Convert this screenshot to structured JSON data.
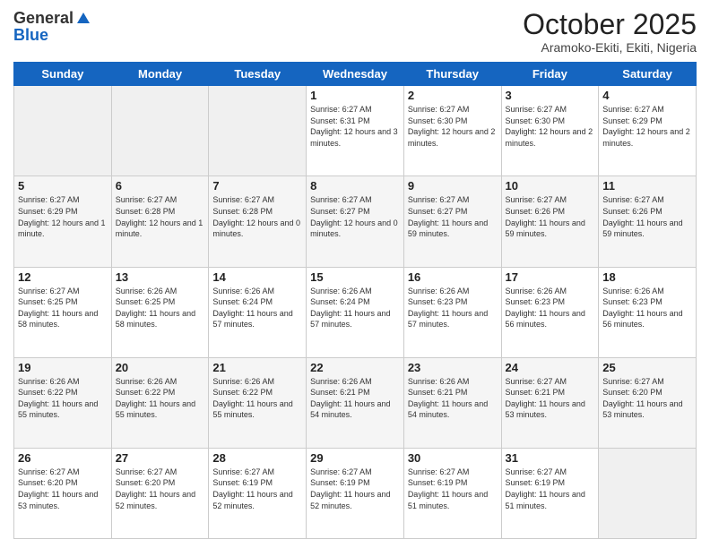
{
  "logo": {
    "general": "General",
    "blue": "Blue"
  },
  "header": {
    "month": "October 2025",
    "location": "Aramoko-Ekiti, Ekiti, Nigeria"
  },
  "days_of_week": [
    "Sunday",
    "Monday",
    "Tuesday",
    "Wednesday",
    "Thursday",
    "Friday",
    "Saturday"
  ],
  "weeks": [
    [
      {
        "day": "",
        "sunrise": "",
        "sunset": "",
        "daylight": "",
        "empty": true
      },
      {
        "day": "",
        "sunrise": "",
        "sunset": "",
        "daylight": "",
        "empty": true
      },
      {
        "day": "",
        "sunrise": "",
        "sunset": "",
        "daylight": "",
        "empty": true
      },
      {
        "day": "1",
        "sunrise": "Sunrise: 6:27 AM",
        "sunset": "Sunset: 6:31 PM",
        "daylight": "Daylight: 12 hours and 3 minutes."
      },
      {
        "day": "2",
        "sunrise": "Sunrise: 6:27 AM",
        "sunset": "Sunset: 6:30 PM",
        "daylight": "Daylight: 12 hours and 2 minutes."
      },
      {
        "day": "3",
        "sunrise": "Sunrise: 6:27 AM",
        "sunset": "Sunset: 6:30 PM",
        "daylight": "Daylight: 12 hours and 2 minutes."
      },
      {
        "day": "4",
        "sunrise": "Sunrise: 6:27 AM",
        "sunset": "Sunset: 6:29 PM",
        "daylight": "Daylight: 12 hours and 2 minutes."
      }
    ],
    [
      {
        "day": "5",
        "sunrise": "Sunrise: 6:27 AM",
        "sunset": "Sunset: 6:29 PM",
        "daylight": "Daylight: 12 hours and 1 minute."
      },
      {
        "day": "6",
        "sunrise": "Sunrise: 6:27 AM",
        "sunset": "Sunset: 6:28 PM",
        "daylight": "Daylight: 12 hours and 1 minute."
      },
      {
        "day": "7",
        "sunrise": "Sunrise: 6:27 AM",
        "sunset": "Sunset: 6:28 PM",
        "daylight": "Daylight: 12 hours and 0 minutes."
      },
      {
        "day": "8",
        "sunrise": "Sunrise: 6:27 AM",
        "sunset": "Sunset: 6:27 PM",
        "daylight": "Daylight: 12 hours and 0 minutes."
      },
      {
        "day": "9",
        "sunrise": "Sunrise: 6:27 AM",
        "sunset": "Sunset: 6:27 PM",
        "daylight": "Daylight: 11 hours and 59 minutes."
      },
      {
        "day": "10",
        "sunrise": "Sunrise: 6:27 AM",
        "sunset": "Sunset: 6:26 PM",
        "daylight": "Daylight: 11 hours and 59 minutes."
      },
      {
        "day": "11",
        "sunrise": "Sunrise: 6:27 AM",
        "sunset": "Sunset: 6:26 PM",
        "daylight": "Daylight: 11 hours and 59 minutes."
      }
    ],
    [
      {
        "day": "12",
        "sunrise": "Sunrise: 6:27 AM",
        "sunset": "Sunset: 6:25 PM",
        "daylight": "Daylight: 11 hours and 58 minutes."
      },
      {
        "day": "13",
        "sunrise": "Sunrise: 6:26 AM",
        "sunset": "Sunset: 6:25 PM",
        "daylight": "Daylight: 11 hours and 58 minutes."
      },
      {
        "day": "14",
        "sunrise": "Sunrise: 6:26 AM",
        "sunset": "Sunset: 6:24 PM",
        "daylight": "Daylight: 11 hours and 57 minutes."
      },
      {
        "day": "15",
        "sunrise": "Sunrise: 6:26 AM",
        "sunset": "Sunset: 6:24 PM",
        "daylight": "Daylight: 11 hours and 57 minutes."
      },
      {
        "day": "16",
        "sunrise": "Sunrise: 6:26 AM",
        "sunset": "Sunset: 6:23 PM",
        "daylight": "Daylight: 11 hours and 57 minutes."
      },
      {
        "day": "17",
        "sunrise": "Sunrise: 6:26 AM",
        "sunset": "Sunset: 6:23 PM",
        "daylight": "Daylight: 11 hours and 56 minutes."
      },
      {
        "day": "18",
        "sunrise": "Sunrise: 6:26 AM",
        "sunset": "Sunset: 6:23 PM",
        "daylight": "Daylight: 11 hours and 56 minutes."
      }
    ],
    [
      {
        "day": "19",
        "sunrise": "Sunrise: 6:26 AM",
        "sunset": "Sunset: 6:22 PM",
        "daylight": "Daylight: 11 hours and 55 minutes."
      },
      {
        "day": "20",
        "sunrise": "Sunrise: 6:26 AM",
        "sunset": "Sunset: 6:22 PM",
        "daylight": "Daylight: 11 hours and 55 minutes."
      },
      {
        "day": "21",
        "sunrise": "Sunrise: 6:26 AM",
        "sunset": "Sunset: 6:22 PM",
        "daylight": "Daylight: 11 hours and 55 minutes."
      },
      {
        "day": "22",
        "sunrise": "Sunrise: 6:26 AM",
        "sunset": "Sunset: 6:21 PM",
        "daylight": "Daylight: 11 hours and 54 minutes."
      },
      {
        "day": "23",
        "sunrise": "Sunrise: 6:26 AM",
        "sunset": "Sunset: 6:21 PM",
        "daylight": "Daylight: 11 hours and 54 minutes."
      },
      {
        "day": "24",
        "sunrise": "Sunrise: 6:27 AM",
        "sunset": "Sunset: 6:21 PM",
        "daylight": "Daylight: 11 hours and 53 minutes."
      },
      {
        "day": "25",
        "sunrise": "Sunrise: 6:27 AM",
        "sunset": "Sunset: 6:20 PM",
        "daylight": "Daylight: 11 hours and 53 minutes."
      }
    ],
    [
      {
        "day": "26",
        "sunrise": "Sunrise: 6:27 AM",
        "sunset": "Sunset: 6:20 PM",
        "daylight": "Daylight: 11 hours and 53 minutes."
      },
      {
        "day": "27",
        "sunrise": "Sunrise: 6:27 AM",
        "sunset": "Sunset: 6:20 PM",
        "daylight": "Daylight: 11 hours and 52 minutes."
      },
      {
        "day": "28",
        "sunrise": "Sunrise: 6:27 AM",
        "sunset": "Sunset: 6:19 PM",
        "daylight": "Daylight: 11 hours and 52 minutes."
      },
      {
        "day": "29",
        "sunrise": "Sunrise: 6:27 AM",
        "sunset": "Sunset: 6:19 PM",
        "daylight": "Daylight: 11 hours and 52 minutes."
      },
      {
        "day": "30",
        "sunrise": "Sunrise: 6:27 AM",
        "sunset": "Sunset: 6:19 PM",
        "daylight": "Daylight: 11 hours and 51 minutes."
      },
      {
        "day": "31",
        "sunrise": "Sunrise: 6:27 AM",
        "sunset": "Sunset: 6:19 PM",
        "daylight": "Daylight: 11 hours and 51 minutes."
      },
      {
        "day": "",
        "sunrise": "",
        "sunset": "",
        "daylight": "",
        "empty": true
      }
    ]
  ]
}
